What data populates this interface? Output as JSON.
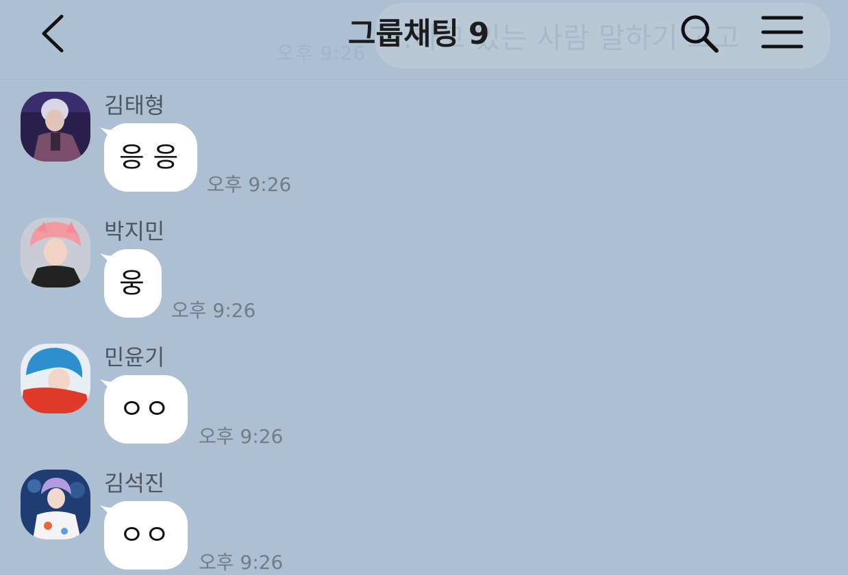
{
  "header": {
    "title": "그룹채팅",
    "member_count": "9",
    "ghost_time": "오후 9:26",
    "ghost_bubble_text": "…하고 있는 사람 말하기 고고"
  },
  "messages": [
    {
      "sender": "김태형",
      "text": "응 응",
      "time": "오후 9:26"
    },
    {
      "sender": "박지민",
      "text": "웅",
      "time": "오후 9:26"
    },
    {
      "sender": "민윤기",
      "text": "ㅇㅇ",
      "time": "오후 9:26"
    },
    {
      "sender": "김석진",
      "text": "ㅇㅇ",
      "time": "오후 9:26"
    }
  ],
  "colors": {
    "background": "#adbfd2",
    "bubble": "#ffffff",
    "time_text": "#6f7c8a",
    "sender_text": "#4c5560"
  },
  "icons": [
    "back-icon",
    "search-icon",
    "menu-icon"
  ]
}
